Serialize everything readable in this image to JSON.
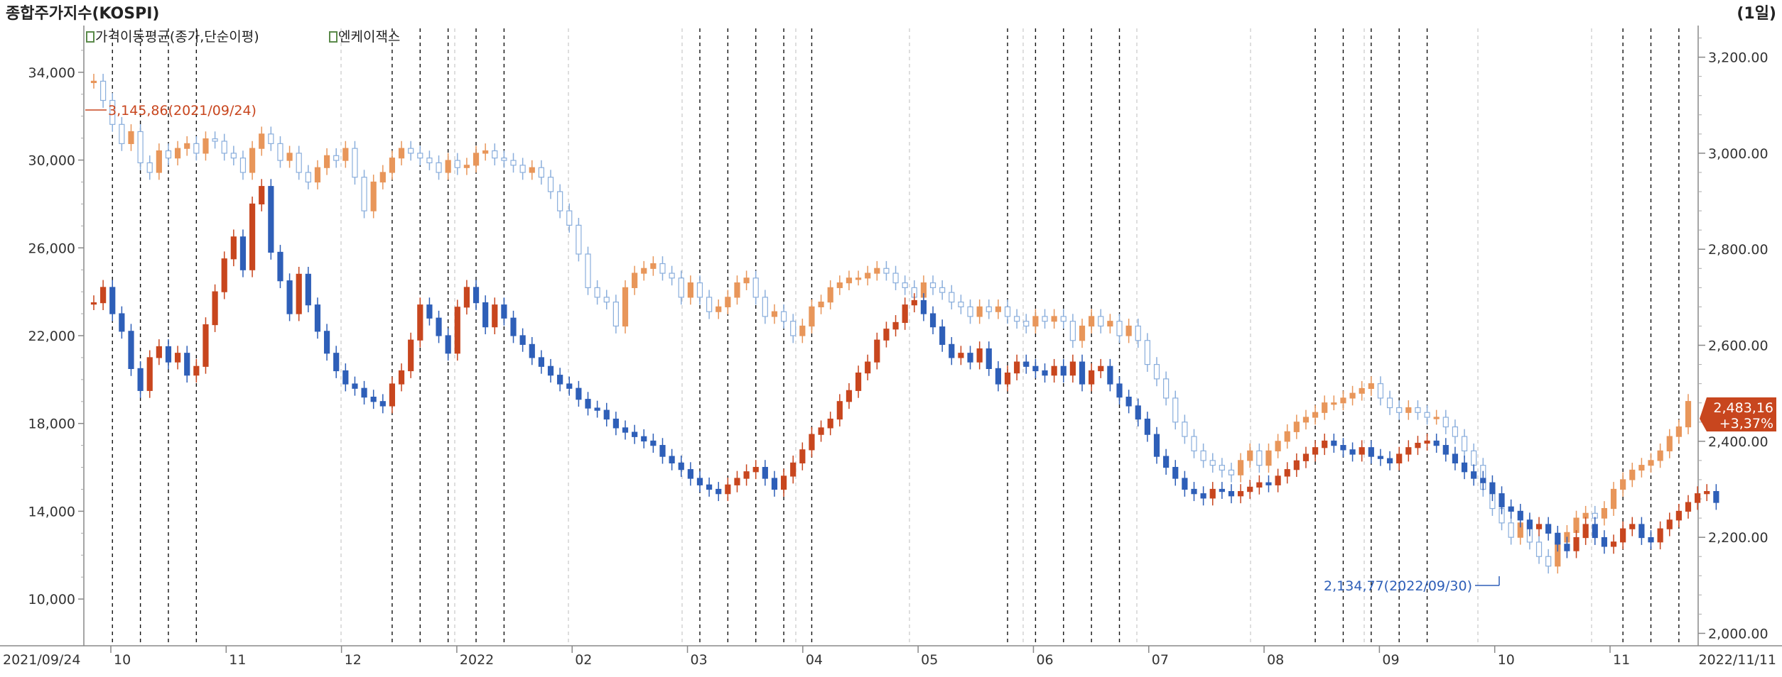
{
  "header": {
    "title": "종합주가지수(KOSPI)",
    "period": "(1일)"
  },
  "legend": [
    {
      "label": "가격이동평균(종가,단순이평)",
      "color": "#5a8a4a"
    },
    {
      "label": "엔케이잭스",
      "color": "#5a8a4a"
    }
  ],
  "colors": {
    "up": "#c8461e",
    "down": "#2e5fb8",
    "up_light": "#e8965a",
    "down_light": "#8aaedc",
    "grid": "#c8c8c8",
    "axis_text": "#333333",
    "current_badge": "#c8461e"
  },
  "chart_data": {
    "type": "candlestick",
    "left_axis": {
      "ylim": [
        8000,
        36000
      ],
      "ticks": [
        "10,000",
        "14,000",
        "18,000",
        "22,000",
        "26,000",
        "30,000",
        "34,000"
      ],
      "tick_values": [
        10000,
        14000,
        18000,
        22000,
        26000,
        30000,
        34000
      ]
    },
    "right_axis": {
      "ylim": [
        1980,
        3260
      ],
      "ticks": [
        "2,000.00",
        "2,200.00",
        "2,400.00",
        "2,600.00",
        "2,800.00",
        "3,000.00",
        "3,200.00"
      ],
      "tick_values": [
        2000,
        2200,
        2400,
        2600,
        2800,
        3000,
        3200
      ]
    },
    "x_range": [
      "2021/09/24",
      "2022/11/11"
    ],
    "x_labels": {
      "start": "2021/09/24",
      "end": "2022/11/11",
      "months": [
        "10",
        "11",
        "12",
        "2022",
        "02",
        "03",
        "04",
        "05",
        "06",
        "07",
        "08",
        "09",
        "10",
        "11"
      ]
    },
    "series": [
      {
        "axis": "right",
        "points": [
          3150,
          3110,
          3060,
          3020,
          3045,
          2980,
          2960,
          3005,
          2990,
          3010,
          3020,
          3000,
          3030,
          3025,
          3000,
          2990,
          2960,
          3010,
          3040,
          3020,
          2985,
          3000,
          2960,
          2940,
          2970,
          2995,
          2985,
          3010,
          2950,
          2880,
          2940,
          2960,
          2990,
          3010,
          3000,
          2990,
          2980,
          2960,
          2985,
          2970,
          2975,
          3000,
          3005,
          2990,
          2985,
          2975,
          2960,
          2970,
          2950,
          2920,
          2880,
          2850,
          2790,
          2720,
          2700,
          2690,
          2640,
          2720,
          2750,
          2760,
          2770,
          2750,
          2740,
          2700,
          2730,
          2700,
          2670,
          2680,
          2700,
          2730,
          2740,
          2700,
          2660,
          2670,
          2650,
          2620,
          2640,
          2680,
          2690,
          2720,
          2730,
          2740,
          2740,
          2750,
          2760,
          2750,
          2730,
          2720,
          2700,
          2730,
          2720,
          2710,
          2690,
          2680,
          2660,
          2680,
          2670,
          2680,
          2660,
          2650,
          2640,
          2660,
          2650,
          2660,
          2650,
          2610,
          2640,
          2660,
          2640,
          2650,
          2620,
          2640,
          2610,
          2560,
          2530,
          2490,
          2440,
          2410,
          2380,
          2360,
          2350,
          2340,
          2330,
          2360,
          2380,
          2350,
          2380,
          2400,
          2420,
          2440,
          2450,
          2460,
          2480,
          2480,
          2490,
          2500,
          2510,
          2520,
          2490,
          2470,
          2460,
          2470,
          2460,
          2450,
          2450,
          2430,
          2410,
          2380,
          2350,
          2300,
          2260,
          2230,
          2200,
          2230,
          2190,
          2160,
          2140,
          2190,
          2210,
          2240,
          2250,
          2240,
          2260,
          2300,
          2320,
          2340,
          2350,
          2360,
          2380,
          2410,
          2430,
          2483
        ]
      },
      {
        "axis": "left",
        "points": [
          23500,
          24200,
          23000,
          22200,
          20500,
          19500,
          21000,
          21500,
          20800,
          21200,
          20200,
          20600,
          22500,
          24000,
          25500,
          26500,
          25000,
          28000,
          28800,
          25800,
          24500,
          23000,
          24800,
          23400,
          22200,
          21200,
          20400,
          19800,
          19600,
          19200,
          19000,
          18800,
          19800,
          20400,
          21800,
          23400,
          22800,
          22000,
          21200,
          23300,
          24200,
          23500,
          22400,
          23400,
          22800,
          22000,
          21600,
          21000,
          20600,
          20200,
          19800,
          19600,
          19100,
          18700,
          18600,
          18200,
          17800,
          17600,
          17400,
          17200,
          17000,
          16500,
          16200,
          15900,
          15500,
          15200,
          15000,
          14800,
          15200,
          15500,
          15800,
          16000,
          15500,
          15000,
          15600,
          16200,
          16800,
          17500,
          17800,
          18200,
          19000,
          19500,
          20300,
          20800,
          21800,
          22300,
          22600,
          23400,
          23600,
          23000,
          22400,
          21600,
          21000,
          21200,
          20800,
          21400,
          20500,
          19800,
          20300,
          20800,
          20600,
          20400,
          20200,
          20600,
          20200,
          20800,
          19800,
          20400,
          20600,
          19800,
          19200,
          18800,
          18200,
          17500,
          16500,
          16000,
          15500,
          15000,
          14800,
          14600,
          15000,
          14900,
          14700,
          14900,
          15100,
          15300,
          15200,
          15600,
          15900,
          16300,
          16600,
          16900,
          17200,
          17000,
          16800,
          16600,
          16900,
          16500,
          16400,
          16200,
          16600,
          16900,
          17100,
          17200,
          17000,
          16600,
          16200,
          15800,
          15500,
          15300,
          14800,
          14200,
          14000,
          13600,
          13200,
          13400,
          13000,
          12500,
          12200,
          12800,
          13400,
          12800,
          12400,
          12600,
          13200,
          13400,
          12800,
          12600,
          13200,
          13600,
          14000,
          14400,
          14800,
          14900,
          14400
        ]
      }
    ],
    "annotations": {
      "high": "3,145,86(2021/09/24)",
      "low": "2,134,77(2022/09/30)",
      "current_value": "2,483,16",
      "current_change": "+3,37%"
    }
  }
}
